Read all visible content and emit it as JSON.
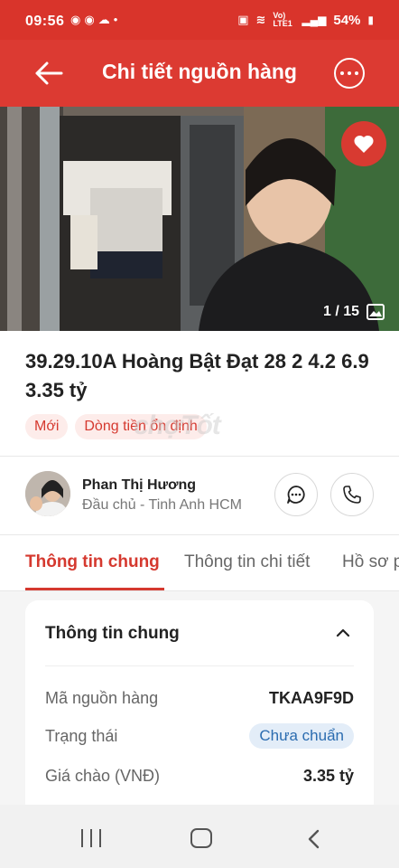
{
  "status_bar": {
    "time": "09:56",
    "battery": "54%",
    "network": "Vo) LTE1"
  },
  "header": {
    "title": "Chi tiết nguồn hàng"
  },
  "gallery": {
    "counter": "1 / 15"
  },
  "listing": {
    "title": "39.29.10A Hoàng Bật Đạt 28 2 4.2 6.9 3.35 tỷ",
    "tags": [
      "Mới",
      "Dòng tiền ổn định"
    ],
    "watermark": "chợTốt"
  },
  "agent": {
    "name": "Phan Thị Hương",
    "role": "Đầu chủ - Tinh Anh HCM"
  },
  "tabs": [
    "Thông tin chung",
    "Thông tin chi tiết",
    "Hồ sơ p"
  ],
  "general_info": {
    "title": "Thông tin chung",
    "rows": [
      {
        "label": "Mã nguồn hàng",
        "value": "TKAA9F9D"
      },
      {
        "label": "Trạng thái",
        "value": "Chưa chuẩn"
      },
      {
        "label": "Giá chào (VNĐ)",
        "value": "3.35 tỷ"
      }
    ]
  },
  "colors": {
    "brand_red": "#dc3a32",
    "status_pill_bg": "#e3edf8"
  }
}
